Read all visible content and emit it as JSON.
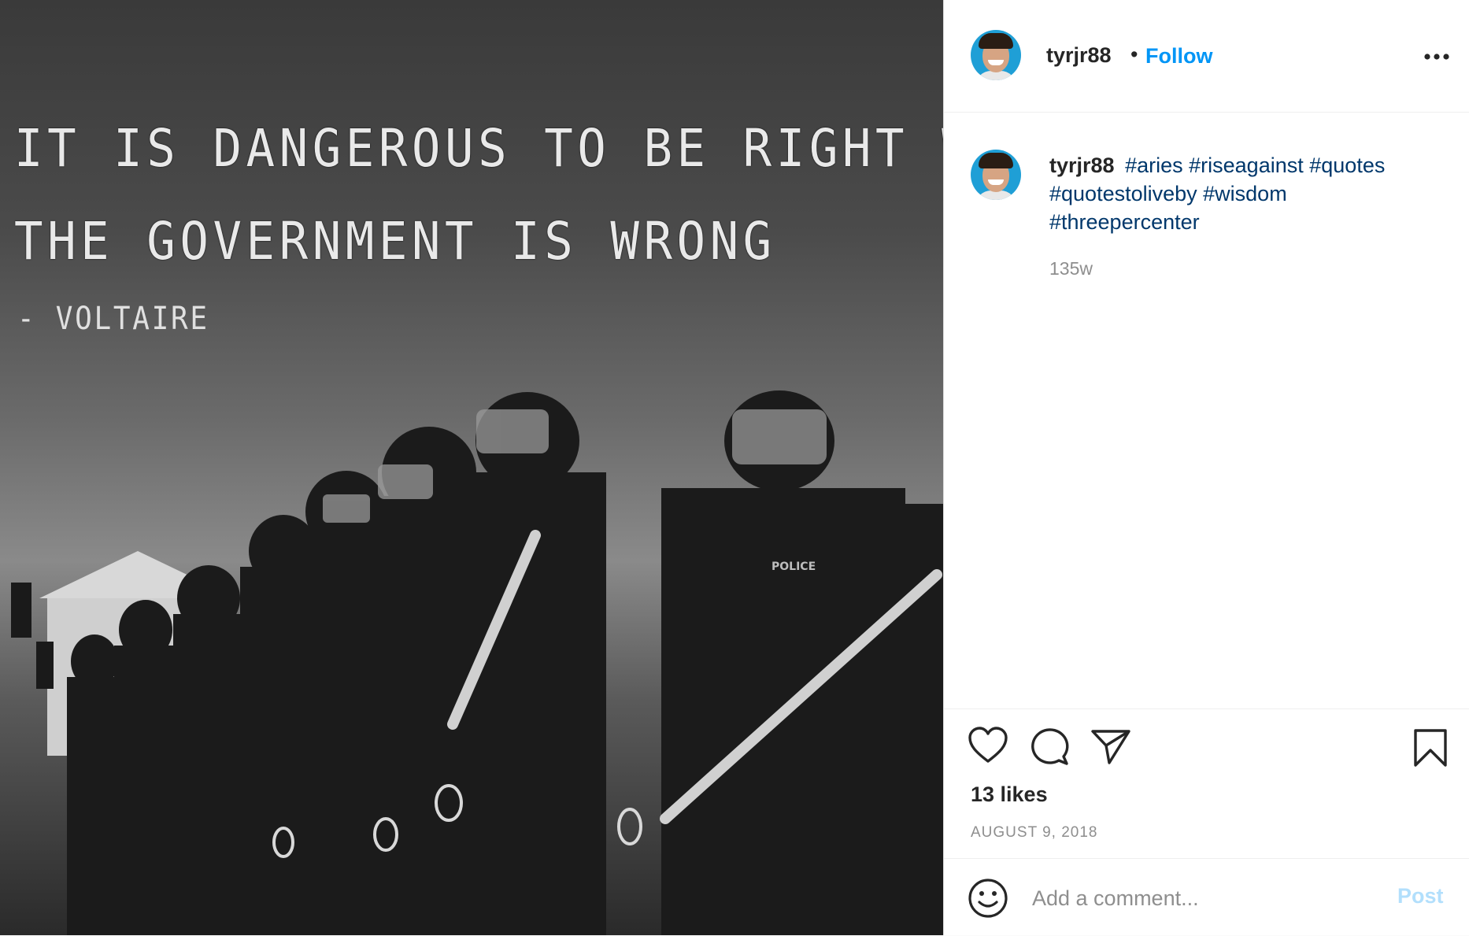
{
  "media": {
    "quote_line1": "IT IS DANGEROUS TO BE RIGHT WHEN",
    "quote_line2": "THE GOVERNMENT IS WRONG",
    "author": "- VOLTAIRE",
    "badge": "POLICE"
  },
  "header": {
    "username": "tyrjr88",
    "separator": "•",
    "follow_label": "Follow",
    "more_icon": "more-horizontal-icon"
  },
  "caption": {
    "username": "tyrjr88",
    "hashtags": [
      "#aries",
      "#riseagainst",
      "#quotes",
      "#quotestoliveby",
      "#wisdom",
      "#threepercenter"
    ],
    "time": "135w"
  },
  "actions": {
    "icons": [
      "heart-icon",
      "comment-icon",
      "share-icon",
      "bookmark-icon"
    ],
    "likes": "13 likes",
    "date": "AUGUST 9, 2018"
  },
  "comment": {
    "placeholder": "Add a comment...",
    "post_label": "Post",
    "emoji_icon": "emoji-icon"
  },
  "colors": {
    "accent": "#0095f6",
    "hashtag": "#00376b",
    "post_disabled": "#b2dffc",
    "muted": "#8e8e8e"
  }
}
